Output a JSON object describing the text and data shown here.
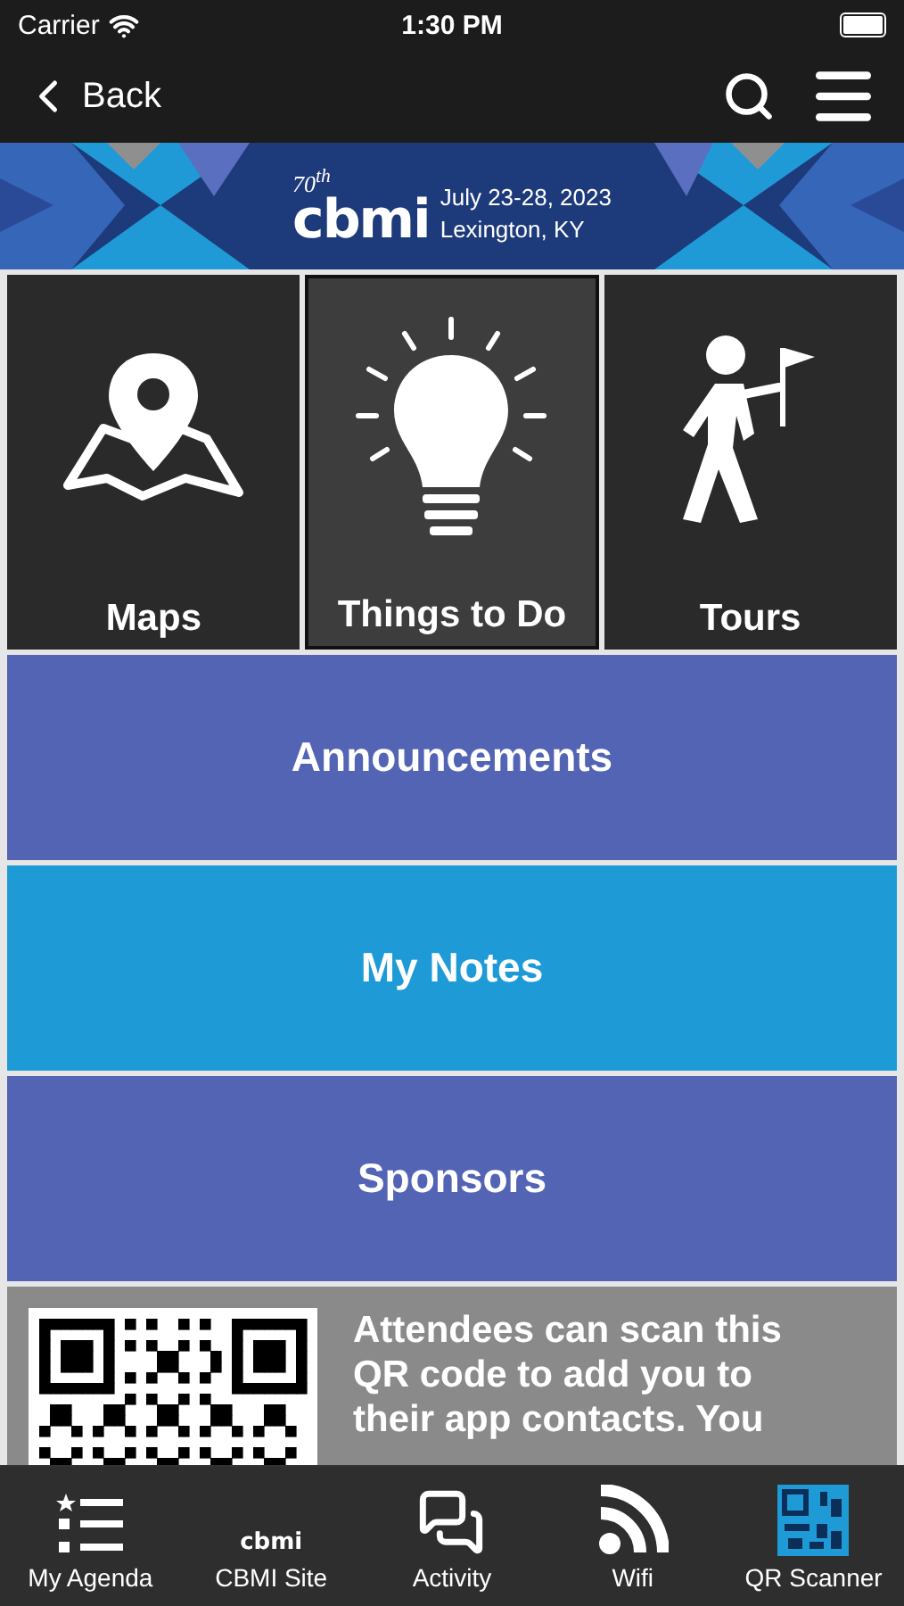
{
  "status_bar": {
    "carrier": "Carrier",
    "time": "1:30 PM"
  },
  "nav": {
    "back": "Back"
  },
  "banner": {
    "edition": "70",
    "edition_suffix": "th",
    "logo": "cbmi",
    "dates": "July 23-28, 2023",
    "location": "Lexington, KY"
  },
  "tiles": [
    {
      "kind": "map",
      "label": "Maps",
      "selected": false
    },
    {
      "kind": "idea",
      "label": "Things to Do",
      "selected": true
    },
    {
      "kind": "walker",
      "label": "Tours",
      "selected": false
    }
  ],
  "buttons": [
    {
      "label": "Announcements",
      "color": "#5264b3"
    },
    {
      "label": "My Notes",
      "color": "#1e9bd7"
    },
    {
      "label": "Sponsors",
      "color": "#5264b3"
    }
  ],
  "qr_card": {
    "text": "Attendees can scan this QR code to add you to their app contacts. You"
  },
  "tab_bar": [
    {
      "kind": "agenda",
      "label": "My Agenda"
    },
    {
      "kind": "site",
      "label": "CBMI Site",
      "logo": "cbmi"
    },
    {
      "kind": "activity",
      "label": "Activity"
    },
    {
      "kind": "wifi",
      "label": "Wifi"
    },
    {
      "kind": "qr",
      "label": "QR Scanner"
    }
  ]
}
